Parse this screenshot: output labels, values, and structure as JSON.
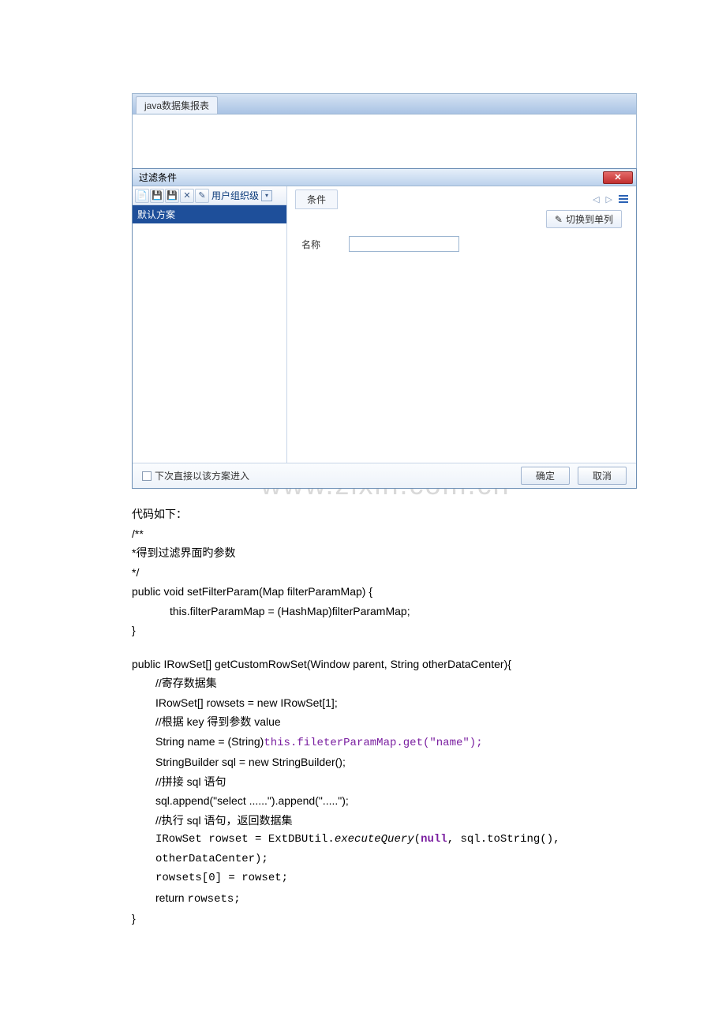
{
  "app": {
    "tab_title": "java数据集报表"
  },
  "dialog": {
    "title": "过滤条件",
    "close_glyph": "✕",
    "toolbar": {
      "level_label": "用户组织级"
    },
    "scheme_selected": "默认方案",
    "condition_tab": "条件",
    "switch_btn": "切换到单列",
    "form": {
      "name_label": "名称"
    },
    "footer": {
      "checkbox_label": "下次直接以该方案进入",
      "ok": "确定",
      "cancel": "取消"
    }
  },
  "watermark": "www.zixin.com.cn",
  "code": {
    "intro": "代码如下：",
    "c1": "/**",
    "c2": "*得到过滤界面旳参数",
    "c3": "*/",
    "l_sig1": "public void setFilterParam(Map filterParamMap) {",
    "l_body1": "this.filterParamMap = (HashMap)filterParamMap;",
    "l_end1": "}",
    "l_sig2": "public IRowSet[] getCustomRowSet(Window parent, String otherDataCenter){",
    "l2_a": "//寄存数据集",
    "l2_b": "IRowSet[] rowsets = new IRowSet[1];",
    "l2_c": "//根据 key 得到参数 value",
    "l2_d_pre": "String name = (String)",
    "l2_d_code": "this.fileterParamMap.get(\"name\");",
    "l2_e": "StringBuilder sql = new StringBuilder();",
    "l2_f": "//拼接 sql 语句",
    "l2_g": "sql.append(\"select ......\").append(\".....\");",
    "l2_h": "//执行 sql 语句，返回数据集",
    "l2_i_pre": "IRowSet rowset = ExtDBUtil.",
    "l2_i_fn": "executeQuery",
    "l2_i_open": "(",
    "l2_i_null": "null",
    "l2_i_rest": ", sql.toString(),",
    "l2_j": "otherDataCenter);",
    "l2_k": "rowsets[0] = rowset;",
    "l2_l_pre": "return ",
    "l2_l_rest": "rowsets;",
    "l_end2": "}"
  }
}
